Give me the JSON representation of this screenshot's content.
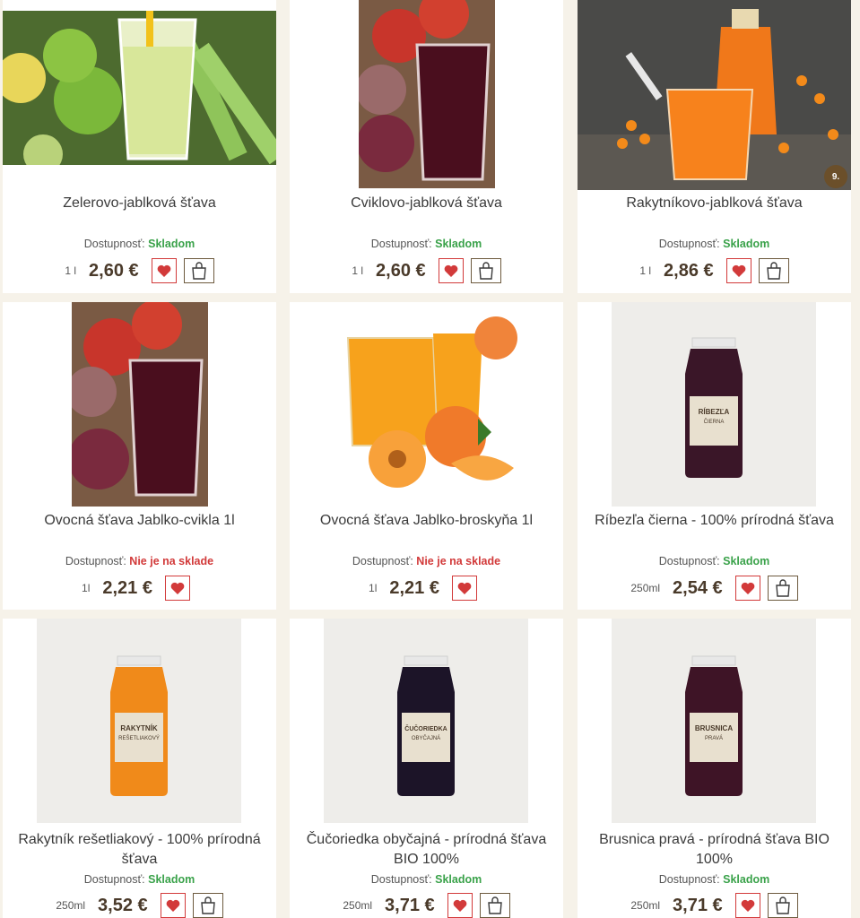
{
  "availability_label": "Dostupnosť:",
  "colors": {
    "in_stock": "#3aa24a",
    "out_of_stock": "#d23a3a",
    "accent": "#6b4f2a"
  },
  "products": [
    {
      "name": "Zelerovo-jablková šťava",
      "availability": "Skladom",
      "unit": "1 l",
      "price": "2,60 €",
      "image": "celery-apple-juice-glass",
      "cart": true
    },
    {
      "name": "Cviklovo-jablková šťava",
      "availability": "Skladom",
      "unit": "1 l",
      "price": "2,60 €",
      "image": "beet-apple-juice-glass",
      "cart": true
    },
    {
      "name": "Rakytníkovo-jablková šťava",
      "availability": "Skladom",
      "unit": "1 l",
      "price": "2,86 €",
      "image": "seabuckthorn-juice-glass",
      "badge": "9.",
      "cart": true
    },
    {
      "name": "Ovocná šťava Jablko-cvikla 1l",
      "availability": "Nie je na sklade",
      "unit": "1l",
      "price": "2,21 €",
      "image": "beet-apple-juice-glass",
      "cart": false
    },
    {
      "name": "Ovocná šťava Jablko-broskyňa 1l",
      "availability": "Nie je na sklade",
      "unit": "1l",
      "price": "2,21 €",
      "image": "peach-juice-jug",
      "cart": false
    },
    {
      "name": "Ríbezľa čierna - 100% prírodná šťava",
      "availability": "Skladom",
      "unit": "250ml",
      "price": "2,54 €",
      "image": "blackcurrant-bottle",
      "cart": true
    },
    {
      "name": "Rakytník rešetliakový - 100% prírodná šťava",
      "availability": "Skladom",
      "unit": "250ml",
      "price": "3,52 €",
      "image": "seabuckthorn-bottle",
      "cart": true
    },
    {
      "name": "Čučoriedka obyčajná - prírodná šťava BIO 100%",
      "availability": "Skladom",
      "unit": "250ml",
      "price": "3,71 €",
      "image": "blueberry-bottle",
      "cart": true
    },
    {
      "name": "Brusnica pravá - prírodná šťava BIO 100%",
      "availability": "Skladom",
      "unit": "250ml",
      "price": "3,71 €",
      "image": "cranberry-bottle",
      "cart": true
    }
  ],
  "bottle_labels": {
    "blackcurrant": [
      "RÍBEZĽA",
      "ČIERNA"
    ],
    "seabuckthorn": [
      "RAKYTNÍK",
      "REŠETLIAKOVÝ"
    ],
    "blueberry": [
      "ČUČORIEDKA",
      "OBYČAJNÁ"
    ],
    "cranberry": [
      "BRUSNICA",
      "PRAVÁ"
    ]
  }
}
